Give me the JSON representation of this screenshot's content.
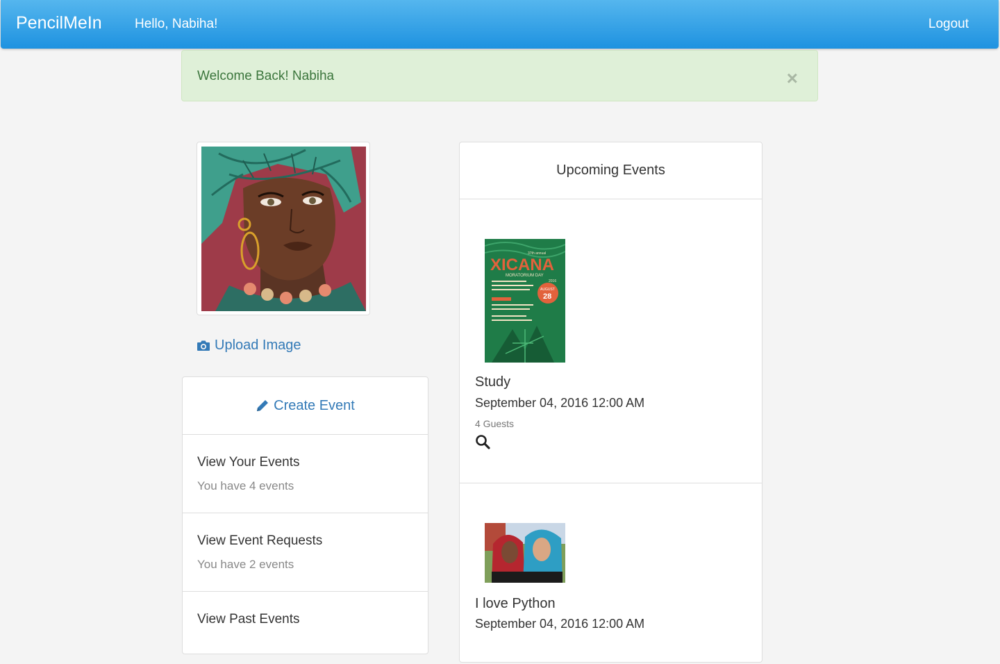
{
  "nav": {
    "brand": "PencilMeIn",
    "greeting": "Hello, Nabiha!",
    "logout": "Logout"
  },
  "alert": {
    "message": "Welcome Back! Nabiha",
    "close": "×"
  },
  "profile": {
    "upload_label": "Upload Image"
  },
  "menu": {
    "create_event": "Create Event",
    "items": [
      {
        "title": "View Your Events",
        "subtitle": "You have 4 events"
      },
      {
        "title": "View Event Requests",
        "subtitle": "You have 2 events"
      },
      {
        "title": "View Past Events",
        "subtitle": ""
      }
    ]
  },
  "upcoming": {
    "heading": "Upcoming Events",
    "events": [
      {
        "title": "Study",
        "date": "September 04, 2016 12:00 AM",
        "guests": "4 Guests",
        "poster": {
          "top_small": "37th annual",
          "name": "XICANA",
          "subtitle": "MORATORIUM DAY",
          "year": "2016",
          "month": "AUGUST",
          "day": "28"
        }
      },
      {
        "title": "I love Python",
        "date": "September 04, 2016 12:00 AM",
        "guests": "",
        "poster": {}
      }
    ]
  },
  "colors": {
    "nav_top": "#55b6ee",
    "nav_bottom": "#1e92e0",
    "link": "#337ab7",
    "alert_bg": "#dff0d8",
    "alert_text": "#3c763d"
  }
}
